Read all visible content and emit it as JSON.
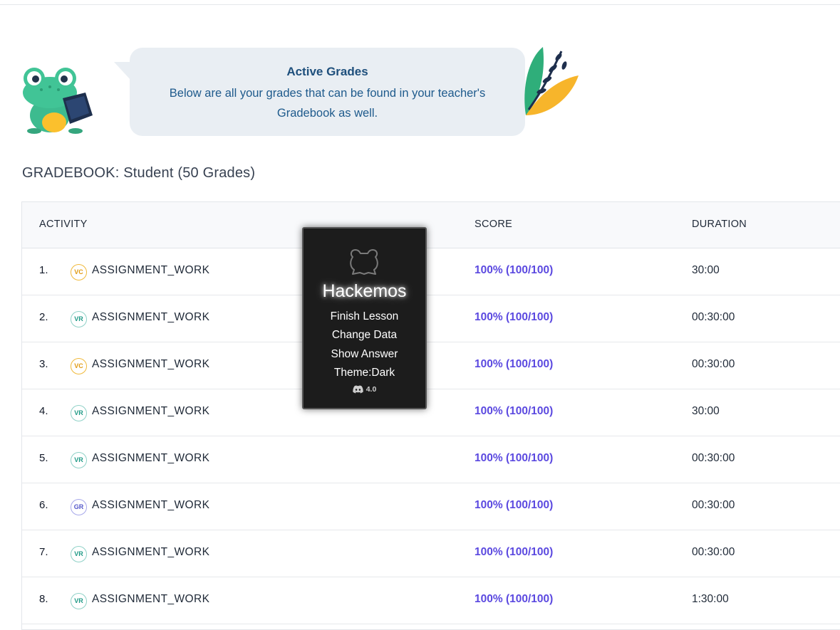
{
  "banner": {
    "title": "Active Grades",
    "text": "Below are all your grades that can be found in your teacher's Gradebook as well."
  },
  "gradebook": {
    "title": "GRADEBOOK: Student (50 Grades)",
    "columns": {
      "activity": "ACTIVITY",
      "score": "SCORE",
      "duration": "DURATION"
    },
    "rows": [
      {
        "num": "1.",
        "badge": "VC",
        "activity": "ASSIGNMENT_WORK",
        "score": "100% (100/100)",
        "duration": "30:00"
      },
      {
        "num": "2.",
        "badge": "VR",
        "activity": "ASSIGNMENT_WORK",
        "score": "100% (100/100)",
        "duration": "00:30:00"
      },
      {
        "num": "3.",
        "badge": "VC",
        "activity": "ASSIGNMENT_WORK",
        "score": "100% (100/100)",
        "duration": "00:30:00"
      },
      {
        "num": "4.",
        "badge": "VR",
        "activity": "ASSIGNMENT_WORK",
        "score": "100% (100/100)",
        "duration": "30:00"
      },
      {
        "num": "5.",
        "badge": "VR",
        "activity": "ASSIGNMENT_WORK",
        "score": "100% (100/100)",
        "duration": "00:30:00"
      },
      {
        "num": "6.",
        "badge": "GR",
        "activity": "ASSIGNMENT_WORK",
        "score": "100% (100/100)",
        "duration": "00:30:00"
      },
      {
        "num": "7.",
        "badge": "VR",
        "activity": "ASSIGNMENT_WORK",
        "score": "100% (100/100)",
        "duration": "00:30:00"
      },
      {
        "num": "8.",
        "badge": "VR",
        "activity": "ASSIGNMENT_WORK",
        "score": "100% (100/100)",
        "duration": "1:30:00"
      }
    ]
  },
  "popup": {
    "title": "Hackemos",
    "menu": [
      "Finish Lesson",
      "Change Data",
      "Show Answer",
      "Theme:Dark"
    ],
    "version": "4.0",
    "icon": "discord-icon"
  },
  "colors": {
    "score": "#5b49e0",
    "banner_title": "#1e4f7c",
    "badge_vc": "#e09a12",
    "badge_vr": "#1f9a86",
    "badge_gr": "#5356c9"
  }
}
